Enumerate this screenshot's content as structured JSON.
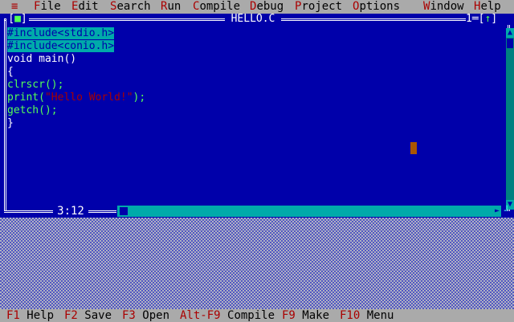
{
  "menu": {
    "system": "≡",
    "items": [
      {
        "hot": "F",
        "rest": "ile"
      },
      {
        "hot": "E",
        "rest": "dit"
      },
      {
        "hot": "S",
        "rest": "earch"
      },
      {
        "hot": "R",
        "rest": "un"
      },
      {
        "hot": "C",
        "rest": "ompile"
      },
      {
        "hot": "D",
        "rest": "ebug"
      },
      {
        "hot": "P",
        "rest": "roject"
      },
      {
        "hot": "O",
        "rest": "ptions"
      },
      {
        "hot": "W",
        "rest": "indow"
      },
      {
        "hot": "H",
        "rest": "elp"
      }
    ]
  },
  "editor": {
    "close_box": "■",
    "title": "HELLO.C",
    "window_number": "1",
    "zoom_icon": "↑",
    "cursor_position": "3:12",
    "code_lines": [
      "#include<stdio.h>",
      "#include<conio.h>",
      "void main()",
      "{",
      "clrscr();",
      "print(",
      "\"Hello World!\"",
      ");",
      "getch();",
      "}"
    ]
  },
  "statusbar": {
    "items": [
      {
        "key": "F1",
        "label": "Help"
      },
      {
        "key": "F2",
        "label": "Save"
      },
      {
        "key": "F3",
        "label": "Open"
      },
      {
        "key": "Alt-F9",
        "label": "Compile"
      },
      {
        "key": "F9",
        "label": "Make"
      },
      {
        "key": "F10",
        "label": "Menu"
      }
    ]
  },
  "colors": {
    "editor_bg": "#0000aa",
    "menu_bg": "#aaaaaa",
    "hotkey": "#aa0000",
    "code_text": "#55ff55",
    "selection_bg": "#00aaaa",
    "cursor": "#aa5500"
  }
}
